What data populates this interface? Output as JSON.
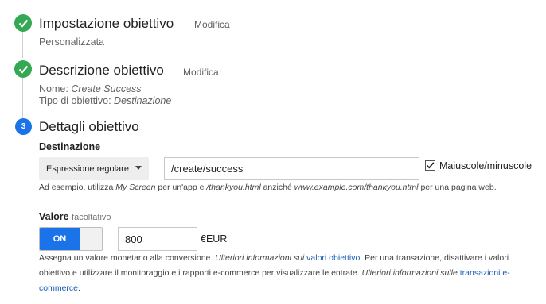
{
  "steps": [
    {
      "title": "Impostazione obiettivo",
      "edit": "Modifica",
      "summary": "Personalizzata"
    },
    {
      "title": "Descrizione obiettivo",
      "edit": "Modifica",
      "name_label": "Nome:",
      "name_value": "Create Success",
      "type_label": "Tipo di obiettivo:",
      "type_value": "Destinazione"
    },
    {
      "number": "3",
      "title": "Dettagli obiettivo"
    }
  ],
  "destination": {
    "label": "Destinazione",
    "match_type": "Espressione regolare",
    "url_value": "/create/success",
    "case_sensitive_label": "Maiuscole/minuscole",
    "case_sensitive_checked": true,
    "hint": {
      "p1": "Ad esempio, utilizza ",
      "i1": "My Screen",
      "p2": " per un'app e ",
      "i2": "/thankyou.html",
      "p3": " anziché ",
      "i3": "www.example.com/thankyou.html",
      "p4": " per una pagina web."
    }
  },
  "value": {
    "label": "Valore",
    "optional": "facoltativo",
    "toggle": "ON",
    "amount": "800",
    "currency": "€EUR",
    "description": {
      "p1": "Assegna un valore monetario alla conversione. ",
      "i1": "Ulteriori informazioni sui ",
      "link1": "valori obiettivo",
      "p2": ". Per una transazione, disattivare i valori",
      "p3": "obiettivo e utilizzare il monitoraggio e i rapporti e-commerce per visualizzare le entrate. ",
      "i2": "Ulteriori informazioni sulle ",
      "link2a": "transazioni e-",
      "link2b": "commerce",
      "p4": "."
    }
  },
  "colors": {
    "complete": "#34a853",
    "active": "#1a73e8",
    "link": "#1a5fb4"
  }
}
